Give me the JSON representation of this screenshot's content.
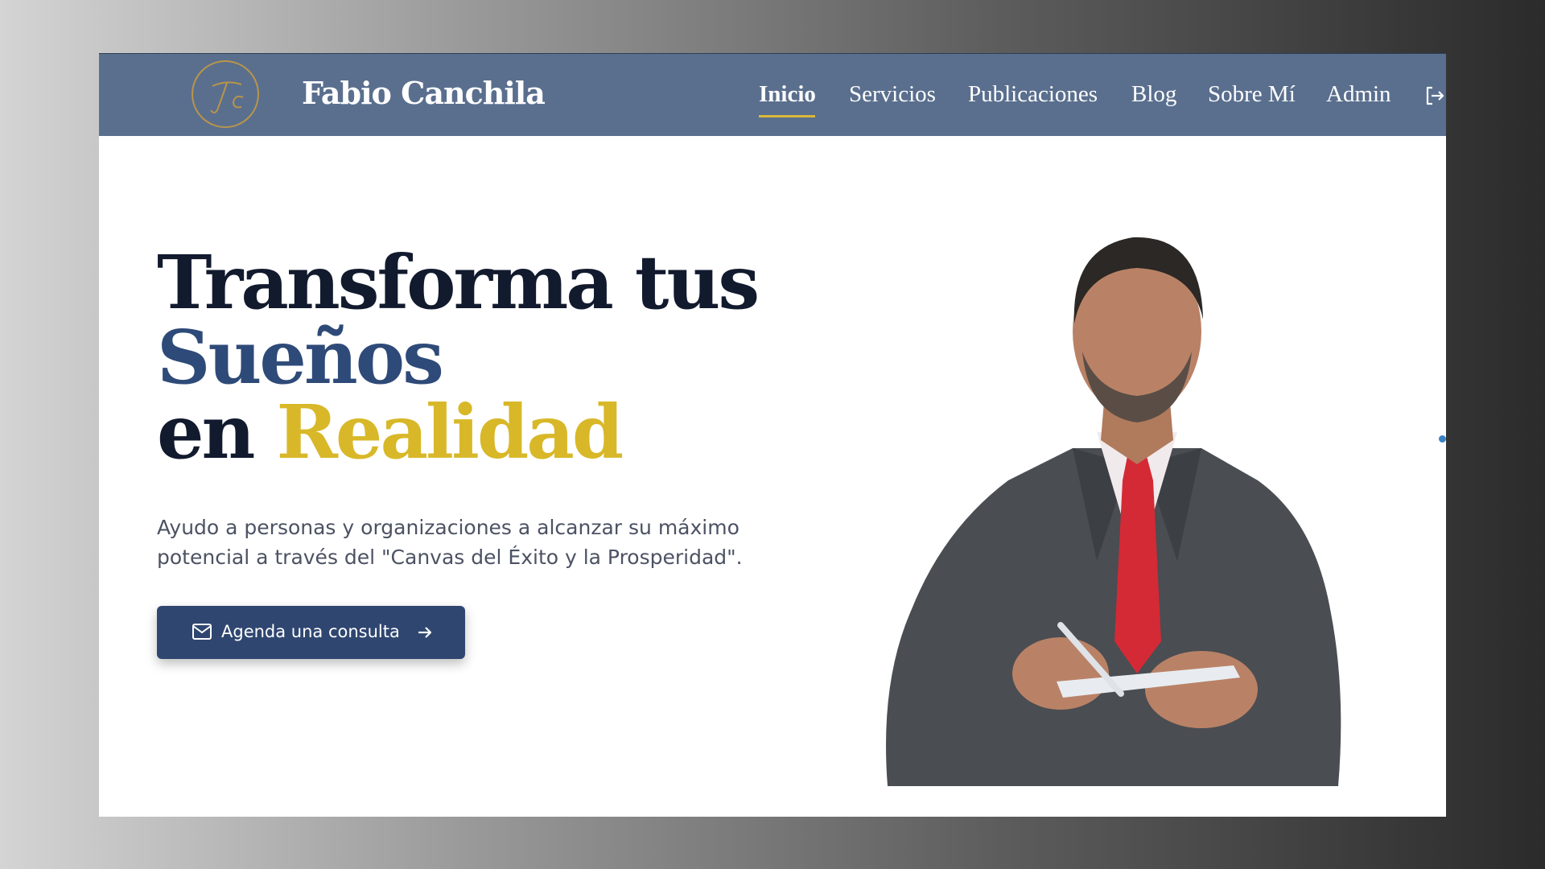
{
  "header": {
    "logo_monogram": "FC",
    "brand_name": "Fabio Canchila",
    "nav": [
      {
        "label": "Inicio",
        "active": true
      },
      {
        "label": "Servicios",
        "active": false
      },
      {
        "label": "Publicaciones",
        "active": false
      },
      {
        "label": "Blog",
        "active": false
      },
      {
        "label": "Sobre Mí",
        "active": false
      },
      {
        "label": "Admin",
        "active": false
      }
    ],
    "logout_icon": "logout-icon"
  },
  "hero": {
    "headline_line1": "Transforma tus",
    "headline_line2": "Sueños",
    "headline_line3_a": "en ",
    "headline_line3_b": "Realidad",
    "subtext": "Ayudo a personas y organizaciones a alcanzar su máximo potencial a través del \"Canvas del Éxito y la Prosperidad\".",
    "cta_label": "Agenda una consulta",
    "cta_icon_left": "mail-icon",
    "cta_icon_right": "arrow-right-icon"
  },
  "colors": {
    "header_bg": "#5a6f8e",
    "accent_gold": "#d8b828",
    "headline_dark": "#121a2e",
    "headline_blue": "#2e4a78",
    "button_bg": "#2f4670"
  }
}
